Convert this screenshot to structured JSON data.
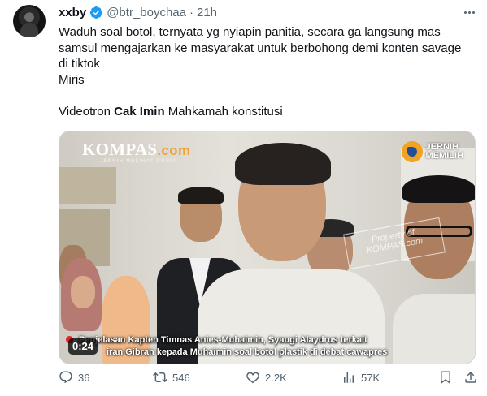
{
  "tweet": {
    "author_name": "xxby",
    "author_handle": "@btr_boychaa",
    "separator": "·",
    "time": "21h",
    "verified": true,
    "text_lines": [
      "Waduh soal botol, ternyata yg nyiapin panitia, secara ga langsung mas",
      "samsul mengajarkan ke masyarakat untuk berbohong demi konten savage",
      "di tiktok",
      "Miris"
    ],
    "text_last": {
      "before": "Videotron ",
      "bold": "Cak Imin",
      "after": " Mahkamah konstitusi"
    }
  },
  "media": {
    "logo_main": "KOMPAS",
    "logo_com": ".com",
    "logo_sub": "JERNIH MELIHAT DUNIA",
    "badge_line1": "JERNIH",
    "badge_line2": "MEMILIH",
    "watermark_line1": "Property of",
    "watermark_line2": "KOMPAS.com",
    "caption_line1": "Penjelasan Kapten Timnas Anies-Muhaimin, Syaugi Alaydrus terkait",
    "caption_line2": "iran Gibran kepada Muhaimin soal botol plastik di debat cawapres",
    "duration": "0:24"
  },
  "actions": {
    "replies": "36",
    "retweets": "546",
    "likes": "2.2K",
    "views": "57K"
  },
  "colors": {
    "text_primary": "#0f1419",
    "text_secondary": "#536471",
    "verified_blue": "#1d9bf0",
    "border": "#cfd9de"
  },
  "icons": [
    "verified-badge-icon",
    "more-icon",
    "reply-icon",
    "retweet-icon",
    "like-icon",
    "views-icon",
    "bookmark-icon",
    "share-icon",
    "play-indicator-icon"
  ]
}
